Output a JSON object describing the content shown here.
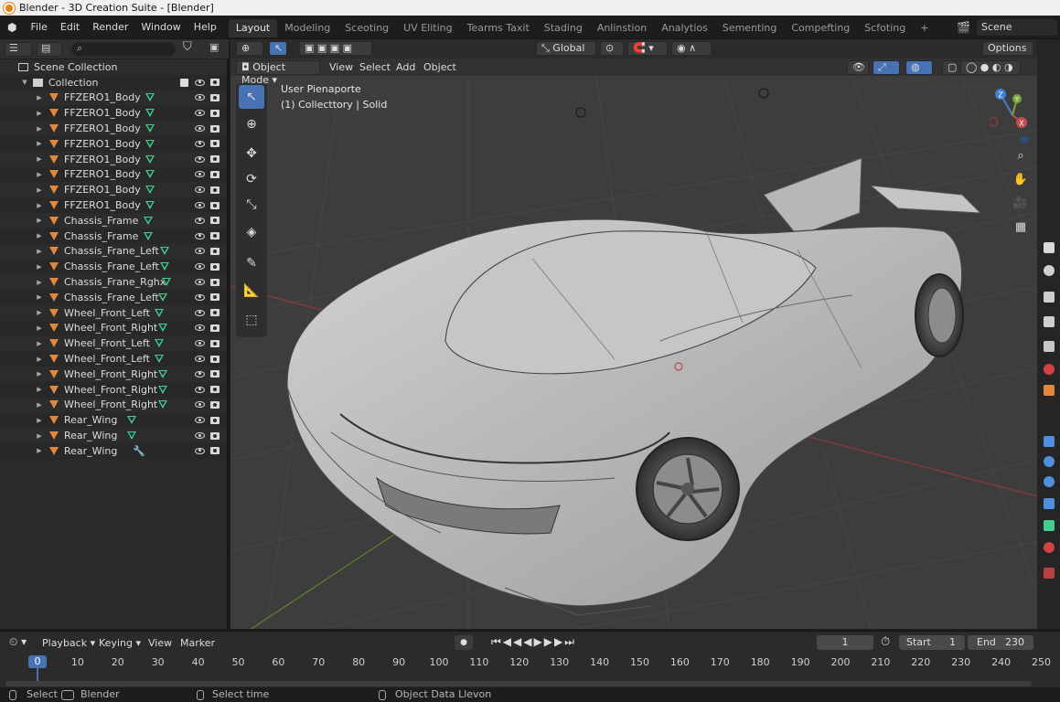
{
  "window": {
    "title": "Blender - 3D Creation Suite - [Blender]"
  },
  "menubar": {
    "items": [
      "File",
      "Edit",
      "Render",
      "Window",
      "Help"
    ]
  },
  "workspaces": [
    {
      "label": "Layout",
      "active": true
    },
    {
      "label": "Modeling"
    },
    {
      "label": "Sceoting"
    },
    {
      "label": "UV Eliting"
    },
    {
      "label": "Tearms Taxit"
    },
    {
      "label": "Stading"
    },
    {
      "label": "Anlinstion"
    },
    {
      "label": "Analytios"
    },
    {
      "label": "Sementing"
    },
    {
      "label": "Compefting"
    },
    {
      "label": "Scfoting"
    },
    {
      "label": "+"
    }
  ],
  "scene": {
    "name": "Scene"
  },
  "outliner": {
    "scene_collection": "Scene Collection",
    "collection": "Collection",
    "items": [
      {
        "name": "FFZERO1_Body",
        "data_icon": "mesh-data-icon"
      },
      {
        "name": "FFZERO1_Body",
        "data_icon": "mesh-data-icon"
      },
      {
        "name": "FFZERO1_Body",
        "data_icon": "mesh-data-icon"
      },
      {
        "name": "FFZERO1_Body",
        "data_icon": "mesh-data-icon"
      },
      {
        "name": "FFZERO1_Body",
        "data_icon": "mesh-data-icon"
      },
      {
        "name": "FFZERO1_Body",
        "data_icon": "mesh-data-icon"
      },
      {
        "name": "FFZERO1_Body",
        "data_icon": "mesh-data-icon"
      },
      {
        "name": "FFZERO1_Body",
        "data_icon": "mesh-data-icon"
      },
      {
        "name": "Chassis_Frame",
        "data_icon": "mesh-data-icon"
      },
      {
        "name": "Chassis_Frame",
        "data_icon": "mesh-data-icon"
      },
      {
        "name": "Chassis_Frane_Left",
        "data_icon": "mesh-data-icon"
      },
      {
        "name": "Chassis_Frane_Left",
        "data_icon": "mesh-data-icon"
      },
      {
        "name": "Chassis_Frane_Rghx",
        "data_icon": "mesh-data-icon"
      },
      {
        "name": "Chassis_Frane_Left",
        "data_icon": "mesh-data-icon"
      },
      {
        "name": "Wheel_Front_Left",
        "data_icon": "mesh-data-icon"
      },
      {
        "name": "Wheel_Front_Right",
        "data_icon": "mesh-data-icon"
      },
      {
        "name": "Wheel_Front_Left",
        "data_icon": "mesh-data-icon"
      },
      {
        "name": "Wheel_Front_Left",
        "data_icon": "mesh-data-icon"
      },
      {
        "name": "Wheel_Front_Right",
        "data_icon": "mesh-data-icon"
      },
      {
        "name": "Wheel_Front_Right",
        "data_icon": "mesh-data-icon"
      },
      {
        "name": "Wheel_Front_Right",
        "data_icon": "mesh-data-icon"
      },
      {
        "name": "Rear_Wing",
        "data_icon": "mesh-data-icon"
      },
      {
        "name": "Rear_Wing",
        "data_icon": "mesh-data-icon"
      },
      {
        "name": "Rear_Wing",
        "data_icon": "modifier-wrench-icon"
      }
    ]
  },
  "viewport": {
    "mode": "Object Mode",
    "menus": [
      "View",
      "Select",
      "Add",
      "Object"
    ],
    "orientation": "Global",
    "options": "Options",
    "info_line1": "User Pienaporte",
    "info_line2": "(1) Collecttory | Solid",
    "gizmo_axes": [
      "Z",
      "Y",
      "X"
    ]
  },
  "timeline": {
    "menus": [
      "Playback",
      "Keying",
      "View",
      "Marker"
    ],
    "current_frame": "1",
    "start_label": "Start",
    "start_value": "1",
    "end_label": "End",
    "end_value": "230",
    "ruler": [
      "0",
      "10",
      "20",
      "30",
      "40",
      "50",
      "60",
      "70",
      "80",
      "90",
      "100",
      "110",
      "120",
      "130",
      "140",
      "150",
      "160",
      "170",
      "180",
      "190",
      "200",
      "210",
      "220",
      "230",
      "240",
      "250"
    ],
    "playhead": "0"
  },
  "statusbar": {
    "items": [
      "Select",
      "Blender",
      "Select time",
      "Object Data Llevon"
    ]
  },
  "colors": {
    "accent": "#4772b3",
    "object_orange": "#e0893e",
    "mesh_green": "#3fcf8e",
    "x_axis": "#c94b4b",
    "y_axis": "#7ba83a",
    "z_axis": "#3f7fd0"
  }
}
